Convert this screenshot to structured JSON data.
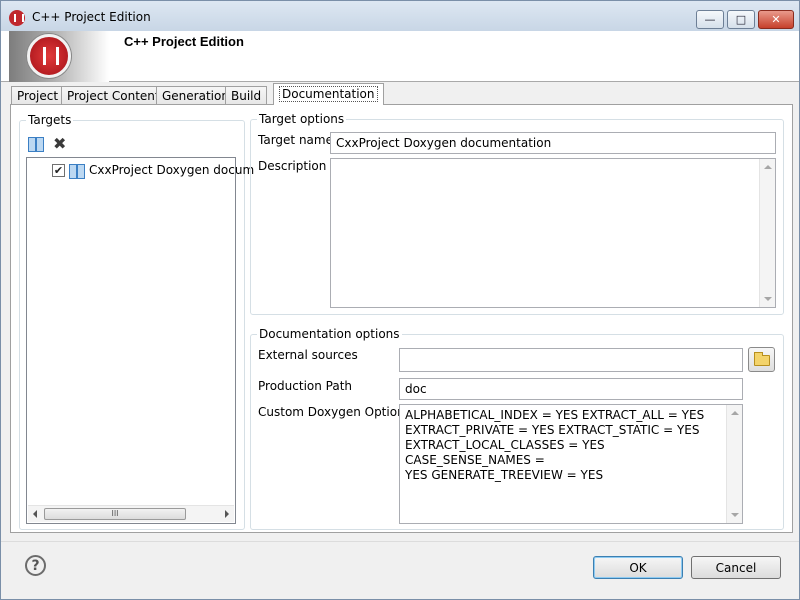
{
  "window": {
    "title": "C++ Project Edition",
    "minimize": "—",
    "maximize": "□",
    "close": "✕"
  },
  "banner": {
    "title": "C++ Project Edition"
  },
  "tabs": [
    {
      "label": "Project"
    },
    {
      "label": "Project Content"
    },
    {
      "label": "Generation"
    },
    {
      "label": "Build"
    },
    {
      "label": "Documentation",
      "active": true
    }
  ],
  "targets": {
    "label": "Targets",
    "items": [
      {
        "label": "CxxProject Doxygen docum",
        "checked": true
      }
    ],
    "scroll_thumb": "III"
  },
  "target_options": {
    "label": "Target options",
    "target_name_label": "Target name",
    "target_name_value": "CxxProject Doxygen documentation",
    "description_label": "Description",
    "description_value": ""
  },
  "documentation_options": {
    "label": "Documentation options",
    "external_sources_label": "External sources",
    "external_sources_value": "",
    "production_path_label": "Production Path",
    "production_path_value": "doc",
    "custom_doxygen_label": "Custom Doxygen Options",
    "custom_doxygen_value": "ALPHABETICAL_INDEX = YES EXTRACT_ALL = YES\nEXTRACT_PRIVATE = YES EXTRACT_STATIC = YES\nEXTRACT_LOCAL_CLASSES = YES  CASE_SENSE_NAMES =\nYES GENERATE_TREEVIEW = YES"
  },
  "footer": {
    "help": "?",
    "ok_label": "OK",
    "cancel_label": "Cancel"
  },
  "colors": {
    "accent": "#c0282d",
    "ok_border": "#3c7fb1"
  },
  "icons": {
    "app": "app-logo-icon",
    "add_target": "book-icon",
    "delete_target": "x-icon",
    "browse": "folder-icon",
    "help": "help-icon"
  }
}
